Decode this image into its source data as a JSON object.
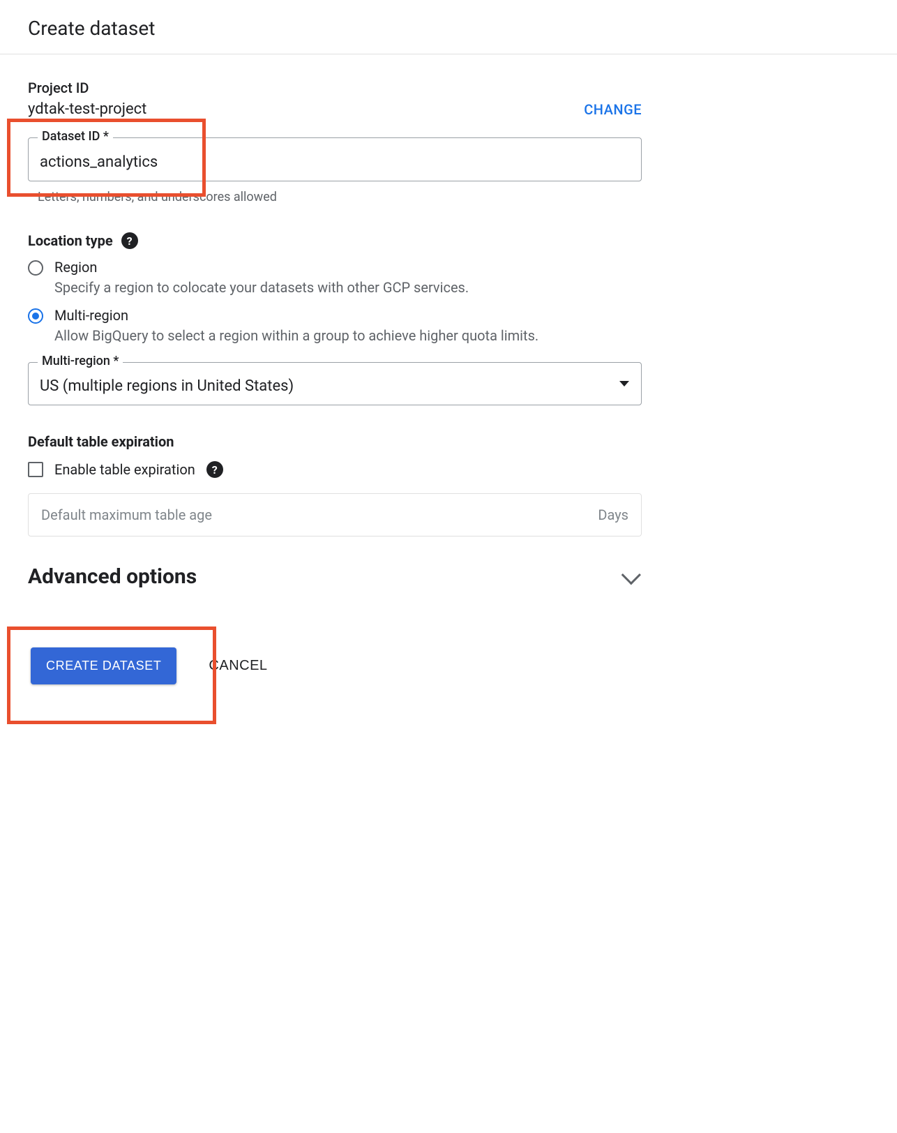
{
  "page_title": "Create dataset",
  "project": {
    "label": "Project ID",
    "id": "ydtak-test-project",
    "change_label": "CHANGE"
  },
  "dataset_id": {
    "label": "Dataset ID *",
    "value": "actions_analytics",
    "helper": "Letters, numbers, and underscores allowed"
  },
  "location": {
    "title": "Location type",
    "options": [
      {
        "label": "Region",
        "desc": "Specify a region to colocate your datasets with other GCP services.",
        "checked": false
      },
      {
        "label": "Multi-region",
        "desc": "Allow BigQuery to select a region within a group to achieve higher quota limits.",
        "checked": true
      }
    ]
  },
  "multiregion": {
    "label": "Multi-region *",
    "value": "US (multiple regions in United States)"
  },
  "expiration": {
    "title": "Default table expiration",
    "checkbox_label": "Enable table expiration",
    "checked": false,
    "max_age_placeholder": "Default maximum table age",
    "unit": "Days"
  },
  "advanced": {
    "title": "Advanced options"
  },
  "actions": {
    "create": "CREATE DATASET",
    "cancel": "CANCEL"
  }
}
